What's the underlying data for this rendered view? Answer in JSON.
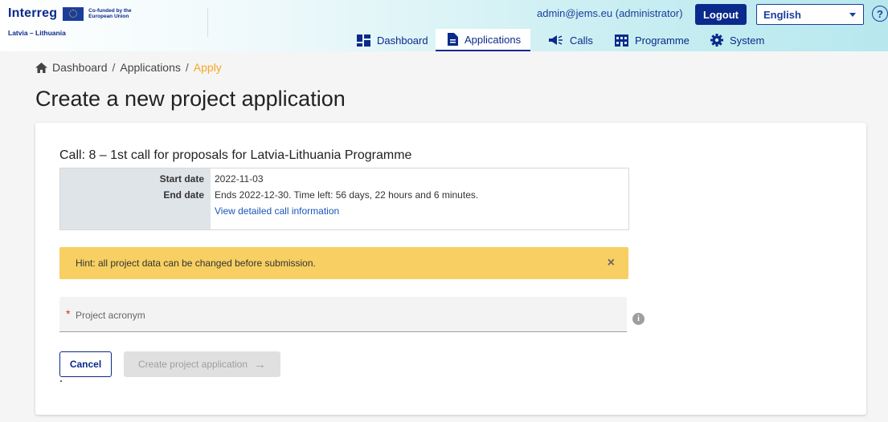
{
  "header": {
    "logo_word": "Interreg",
    "cofunded_text": "Co-funded by the European Union",
    "programme_name": "Latvia – Lithuania",
    "user_email": "admin@jems.eu (administrator)",
    "logout_label": "Logout",
    "language": "English",
    "help_icon": "question-circle-icon"
  },
  "nav": {
    "items": [
      {
        "label": "Dashboard",
        "icon": "dashboard-icon"
      },
      {
        "label": "Applications",
        "icon": "document-icon",
        "active": true
      },
      {
        "label": "Calls",
        "icon": "megaphone-icon"
      },
      {
        "label": "Programme",
        "icon": "building-icon"
      },
      {
        "label": "System",
        "icon": "gear-icon"
      }
    ]
  },
  "breadcrumb": {
    "items": [
      "Dashboard",
      "Applications"
    ],
    "current": "Apply",
    "separator": "/"
  },
  "page": {
    "title": "Create a new project application"
  },
  "call": {
    "title": "Call: 8 – 1st call for proposals for Latvia-Lithuania Programme",
    "start_label": "Start date",
    "start_value": "2022-11-03",
    "end_label": "End date",
    "end_value": "Ends 2022-12-30. Time left: 56 days, 22 hours and 6 minutes.",
    "details_link": "View detailed call information"
  },
  "hint": {
    "text": "Hint: all project data can be changed before submission.",
    "close_symbol": "×"
  },
  "form": {
    "required_marker": "*",
    "acronym_placeholder": "Project acronym",
    "acronym_value": "",
    "info_symbol": "i"
  },
  "actions": {
    "cancel_label": "Cancel",
    "create_label": "Create project application",
    "create_arrow": "→"
  },
  "colors": {
    "primary": "#0a2a8c",
    "hint_bg": "#f7cf62",
    "breadcrumb_current": "#f5a623"
  }
}
